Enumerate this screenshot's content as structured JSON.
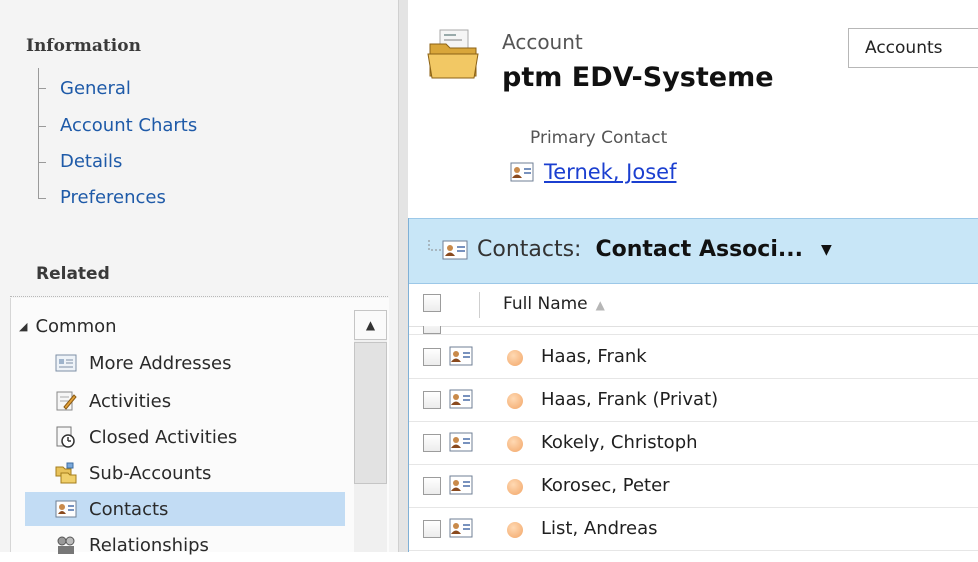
{
  "nav": {
    "information_title": "Information",
    "information_items": [
      {
        "label": "General"
      },
      {
        "label": "Account Charts"
      },
      {
        "label": "Details"
      },
      {
        "label": "Preferences"
      }
    ],
    "related_title": "Related",
    "common_group": "Common",
    "related_items": [
      {
        "label": "More Addresses",
        "icon": "address-book-icon"
      },
      {
        "label": "Activities",
        "icon": "activities-icon"
      },
      {
        "label": "Closed Activities",
        "icon": "closed-activities-icon"
      },
      {
        "label": "Sub-Accounts",
        "icon": "sub-accounts-icon"
      },
      {
        "label": "Contacts",
        "icon": "contact-card-icon",
        "selected": true
      },
      {
        "label": "Relationships",
        "icon": "relationships-icon"
      }
    ]
  },
  "record": {
    "entity_type": "Account",
    "name": "ptm EDV-Systeme",
    "form_selector": "Accounts",
    "primary_contact_label": "Primary Contact",
    "primary_contact_name": "Ternek, Josef"
  },
  "grid": {
    "prefix": "Contacts:",
    "view_name": "Contact Associ...",
    "column_header": "Full Name",
    "rows": [
      {
        "name": "Haas, Frank"
      },
      {
        "name": "Haas, Frank (Privat)"
      },
      {
        "name": "Kokely, Christoph"
      },
      {
        "name": "Korosec, Peter"
      },
      {
        "name": "List, Andreas"
      }
    ]
  },
  "colors": {
    "link": "#1e5aa8",
    "selected": "#c2dcf4",
    "grid_header": "#c8e6f7"
  }
}
